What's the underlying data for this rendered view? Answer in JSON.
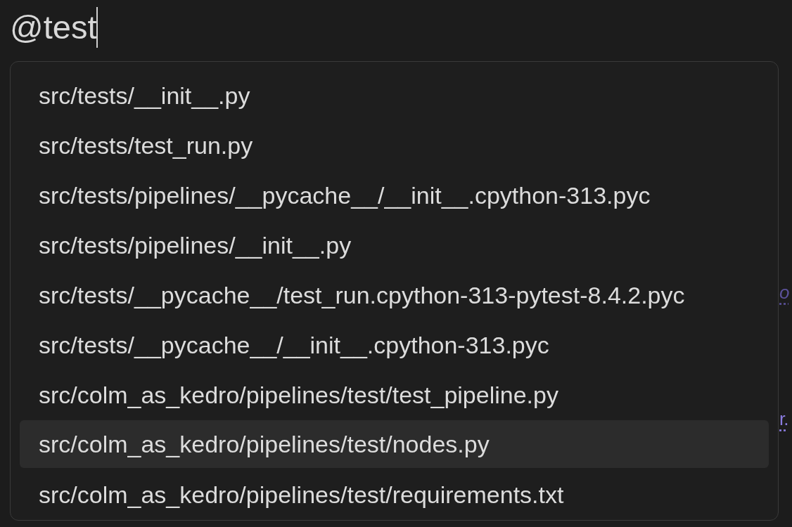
{
  "query": {
    "value": "@test"
  },
  "background_lines": [
    {
      "text": "o",
      "kind": "faint"
    },
    {
      "text": "r.",
      "kind": "strong"
    }
  ],
  "suggestions": [
    {
      "path": "src/tests/__init__.py",
      "selected": false
    },
    {
      "path": "src/tests/test_run.py",
      "selected": false
    },
    {
      "path": "src/tests/pipelines/__pycache__/__init__.cpython-313.pyc",
      "selected": false
    },
    {
      "path": "src/tests/pipelines/__init__.py",
      "selected": false
    },
    {
      "path": "src/tests/__pycache__/test_run.cpython-313-pytest-8.4.2.pyc",
      "selected": false
    },
    {
      "path": "src/tests/__pycache__/__init__.cpython-313.pyc",
      "selected": false
    },
    {
      "path": "src/colm_as_kedro/pipelines/test/test_pipeline.py",
      "selected": false
    },
    {
      "path": "src/colm_as_kedro/pipelines/test/nodes.py",
      "selected": true
    },
    {
      "path": "src/colm_as_kedro/pipelines/test/requirements.txt",
      "selected": false
    }
  ]
}
